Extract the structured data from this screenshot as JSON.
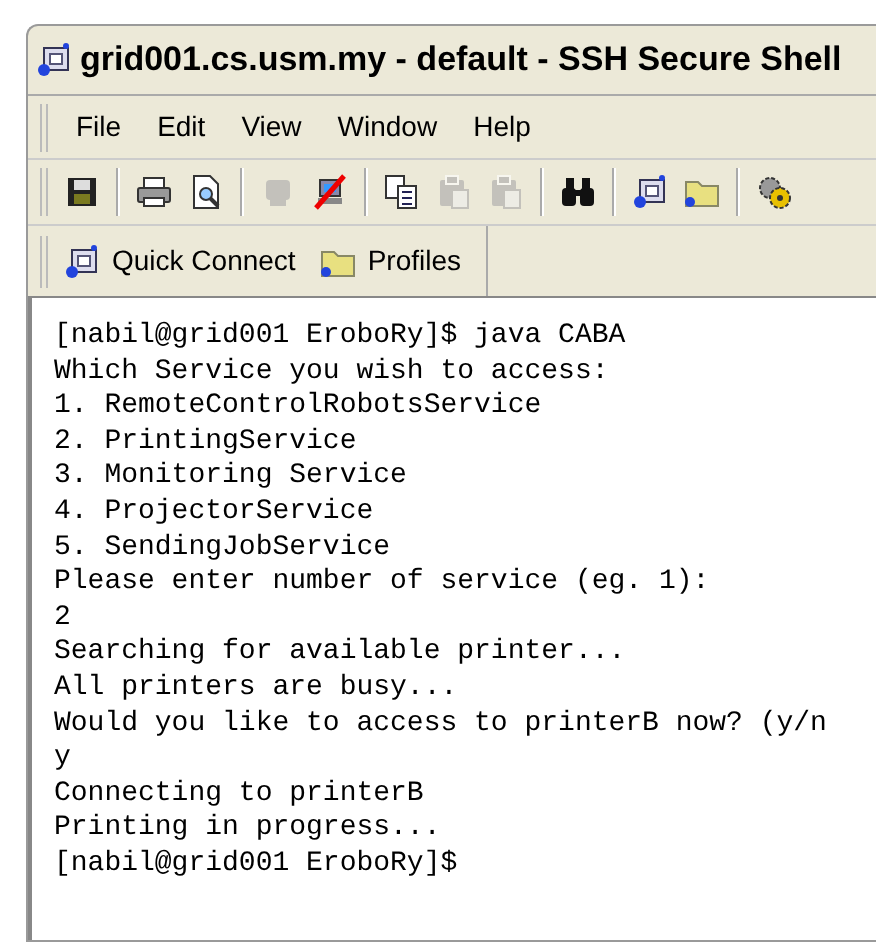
{
  "window": {
    "title": "grid001.cs.usm.my - default - SSH Secure Shell"
  },
  "menu": [
    "File",
    "Edit",
    "View",
    "Window",
    "Help"
  ],
  "toolbar": [
    [
      {
        "kind": "save",
        "disabled": false
      }
    ],
    [
      {
        "kind": "print",
        "disabled": false
      },
      {
        "kind": "preview",
        "disabled": false
      }
    ],
    [
      {
        "kind": "connect",
        "disabled": true
      },
      {
        "kind": "disconnect",
        "disabled": false
      }
    ],
    [
      {
        "kind": "copy",
        "disabled": false
      },
      {
        "kind": "paste",
        "disabled": true
      },
      {
        "kind": "paste",
        "disabled": true
      }
    ],
    [
      {
        "kind": "find",
        "disabled": false
      }
    ],
    [
      {
        "kind": "terminal",
        "disabled": false
      },
      {
        "kind": "folder",
        "disabled": false
      }
    ],
    [
      {
        "kind": "settings",
        "disabled": false
      }
    ]
  ],
  "quickbar": [
    {
      "kind": "terminal",
      "label": "Quick Connect"
    },
    {
      "kind": "folder",
      "label": "Profiles"
    }
  ],
  "terminal": [
    "[nabil@grid001 EroboRy]$ java CABA",
    "Which Service you wish to access:",
    "1. RemoteControlRobotsService",
    "2. PrintingService",
    "3. Monitoring Service",
    "4. ProjectorService",
    "5. SendingJobService",
    "Please enter number of service (eg. 1):",
    "2",
    "Searching for available printer...",
    "All printers are busy...",
    "Would you like to access to printerB now? (y/n",
    "y",
    "Connecting to printerB",
    "Printing in progress...",
    "[nabil@grid001 EroboRy]$"
  ]
}
